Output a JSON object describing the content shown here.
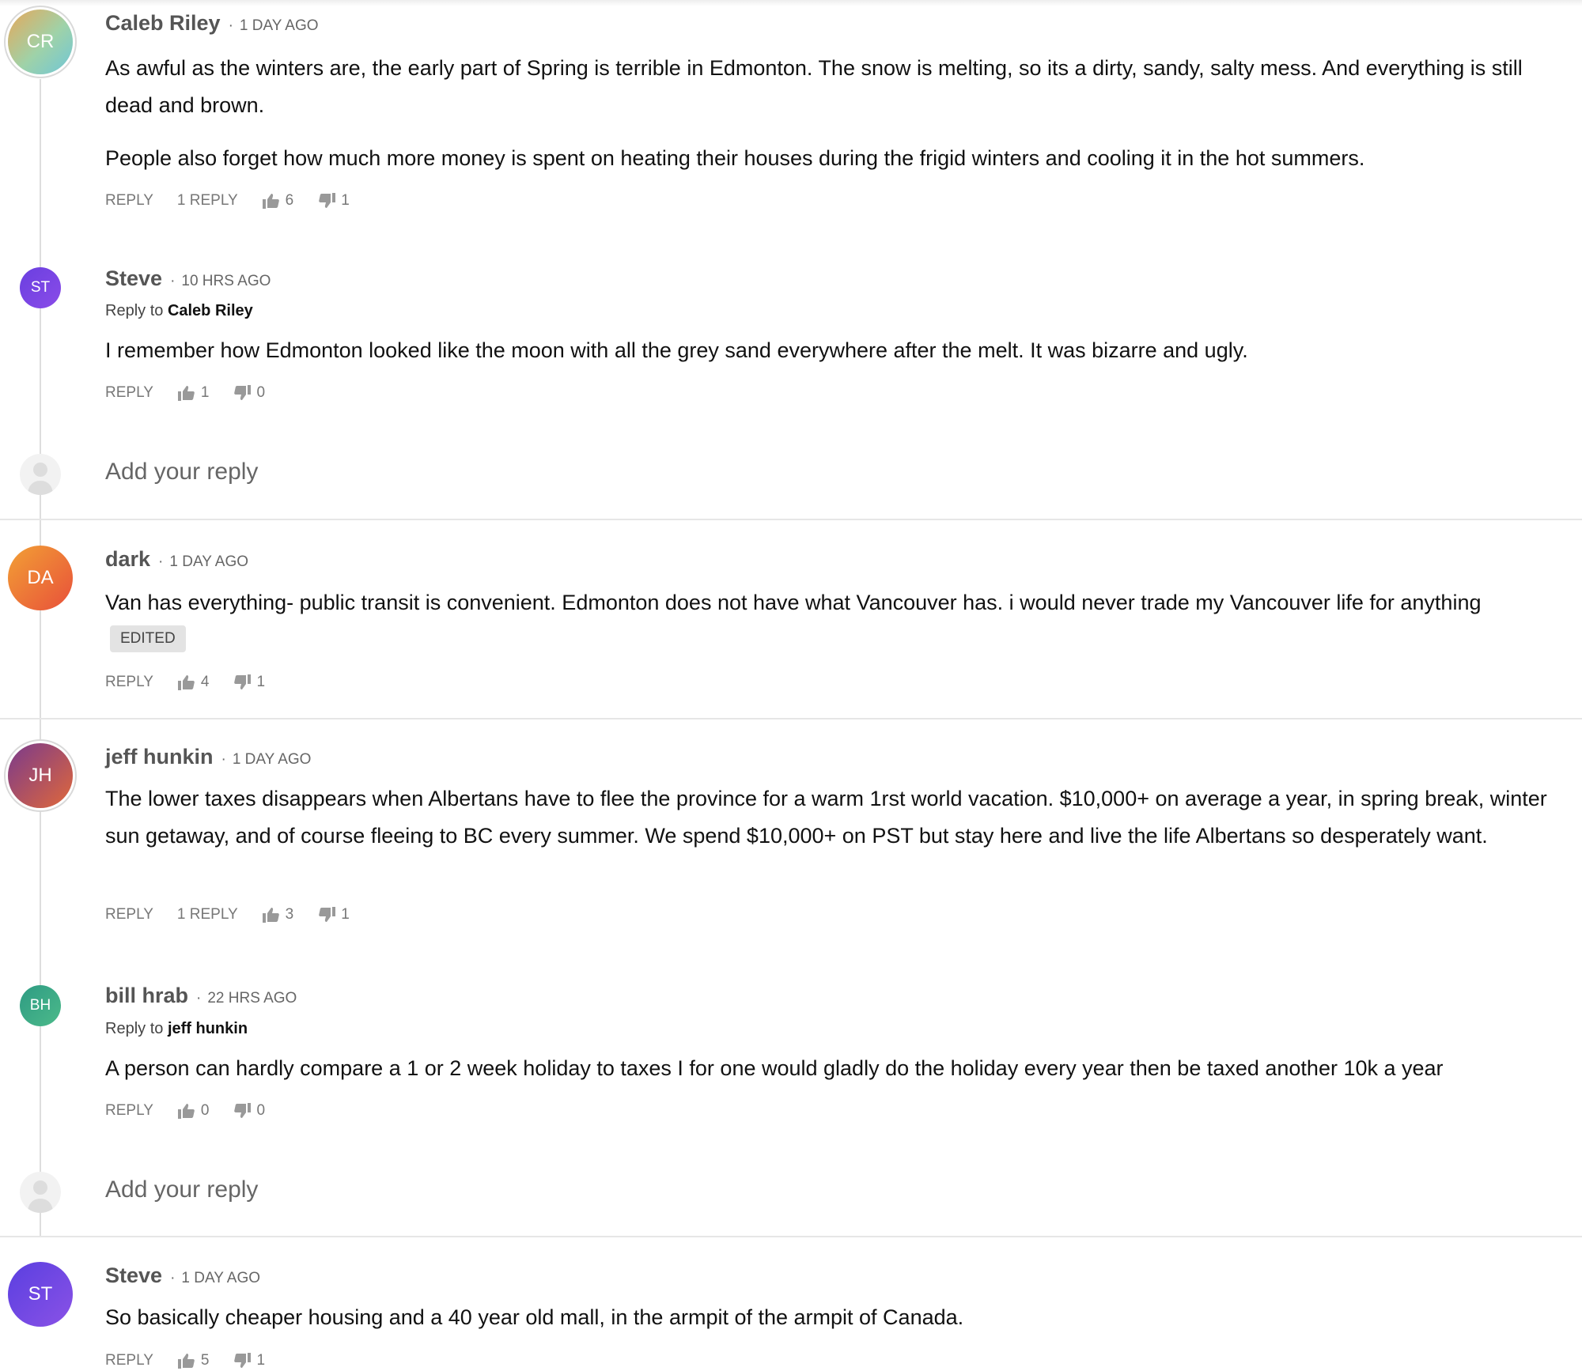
{
  "labels": {
    "reply": "REPLY",
    "reply_to": "Reply to",
    "add_reply": "Add your reply",
    "edited": "EDITED"
  },
  "comments": [
    {
      "initials": "CR",
      "author": "Caleb Riley",
      "time": "1 DAY AGO",
      "text": "As awful as the winters are, the early part of Spring is terrible in Edmonton. The snow is melting, so its a dirty, sandy, salty mess. And everything is still dead and brown.",
      "text2": "People also forget how much more money is spent on heating their houses during the frigid winters and cooling it in the hot summers.",
      "replies_label": "1 REPLY",
      "likes": "6",
      "dislikes": "1",
      "avatar_colors": [
        "#e6a85a",
        "#9fd2a8",
        "#6fc6d8"
      ]
    },
    {
      "initials": "ST",
      "author": "Steve",
      "time": "10 HRS AGO",
      "reply_to": "Caleb Riley",
      "text": "I remember how Edmonton looked like the moon with all the grey sand everywhere after the melt. It was bizarre and ugly.",
      "likes": "1",
      "dislikes": "0",
      "avatar_colors": [
        "#6a3fe0",
        "#8a4ce8"
      ]
    },
    {
      "initials": "DA",
      "author": "dark",
      "time": "1 DAY AGO",
      "text": "Van has everything- public transit is convenient. Edmonton does not have what Vancouver has. i would never trade my Vancouver life for anything",
      "likes": "4",
      "dislikes": "1",
      "avatar_colors": [
        "#f2a035",
        "#e8503a"
      ]
    },
    {
      "initials": "JH",
      "author": "jeff hunkin",
      "time": "1 DAY AGO",
      "text": "The lower taxes disappears when Albertans have to flee the province for a warm 1rst world vacation. $10,000+ on average a year, in spring break, winter sun getaway, and of course fleeing to BC every summer. We spend $10,000+ on PST but stay here and live the life Albertans so desperately want.",
      "replies_label": "1 REPLY",
      "likes": "3",
      "dislikes": "1",
      "avatar_colors": [
        "#7a3a8c",
        "#e0683a"
      ]
    },
    {
      "initials": "BH",
      "author": "bill hrab",
      "time": "22 HRS AGO",
      "reply_to": "jeff hunkin",
      "text": "A person can hardly compare a 1 or 2 week holiday to taxes I for one would gladly do the holiday every year then be taxed another 10k a year",
      "likes": "0",
      "dislikes": "0",
      "avatar_colors": [
        "#2e9b83",
        "#4cba8a"
      ]
    },
    {
      "initials": "ST",
      "author": "Steve",
      "time": "1 DAY AGO",
      "text": "So basically cheaper housing and a 40 year old mall, in the armpit of the armpit of Canada.",
      "likes": "5",
      "dislikes": "1",
      "avatar_colors": [
        "#5a3fe0",
        "#8a52e6"
      ]
    }
  ]
}
